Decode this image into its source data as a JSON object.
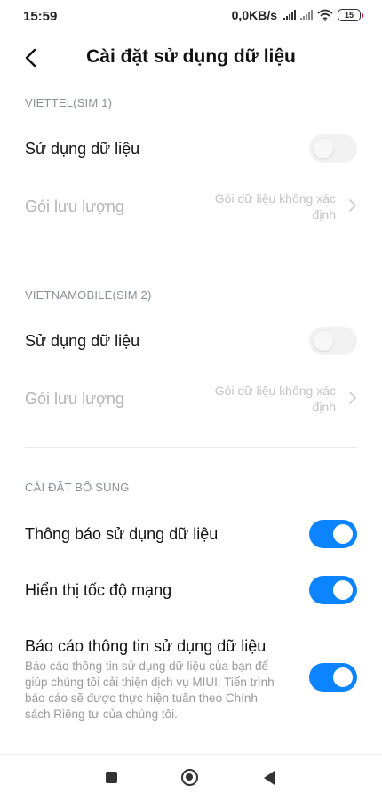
{
  "status_bar": {
    "time": "15:59",
    "net_speed": "0,0KB/s",
    "battery": "15"
  },
  "header": {
    "title": "Cài đặt sử dụng dữ liệu",
    "back_icon": "chevron-left-icon"
  },
  "sim1": {
    "section_label": "VIETTEL(SIM 1)",
    "data_usage_label": "Sử dụng dữ liệu",
    "data_usage_enabled": false,
    "data_plan_label": "Gói lưu lượng",
    "data_plan_value": "Gói dữ liệu không xác định"
  },
  "sim2": {
    "section_label": "VIETNAMOBILE(SIM 2)",
    "data_usage_label": "Sử dụng dữ liệu",
    "data_usage_enabled": false,
    "data_plan_label": "Gói lưu lượng",
    "data_plan_value": "Gói dữ liệu không xác định"
  },
  "extra": {
    "section_label": "CÀI ĐẶT BỔ SUNG",
    "notify_label": "Thông báo sử dụng dữ liệu",
    "notify_enabled": true,
    "speed_label": "Hiển thị tốc độ mạng",
    "speed_enabled": true,
    "report_label": "Báo cáo thông tin sử dụng dữ liệu",
    "report_desc": "Báo cáo thông tin sử dụng dữ liệu của bạn để giúp chúng tôi cải thiện dịch vụ MIUI. Tiến trình báo cáo sẽ được thực hiện tuân theo Chính sách Riêng tư của chúng tôi.",
    "report_enabled": true
  },
  "colors": {
    "accent": "#0d84ff",
    "toggle_off": "#f1f1f1",
    "section_header": "#8a8f99"
  },
  "nav": {
    "recents_icon": "square-icon",
    "home_icon": "circle-home-icon",
    "back_icon": "triangle-back-icon"
  }
}
